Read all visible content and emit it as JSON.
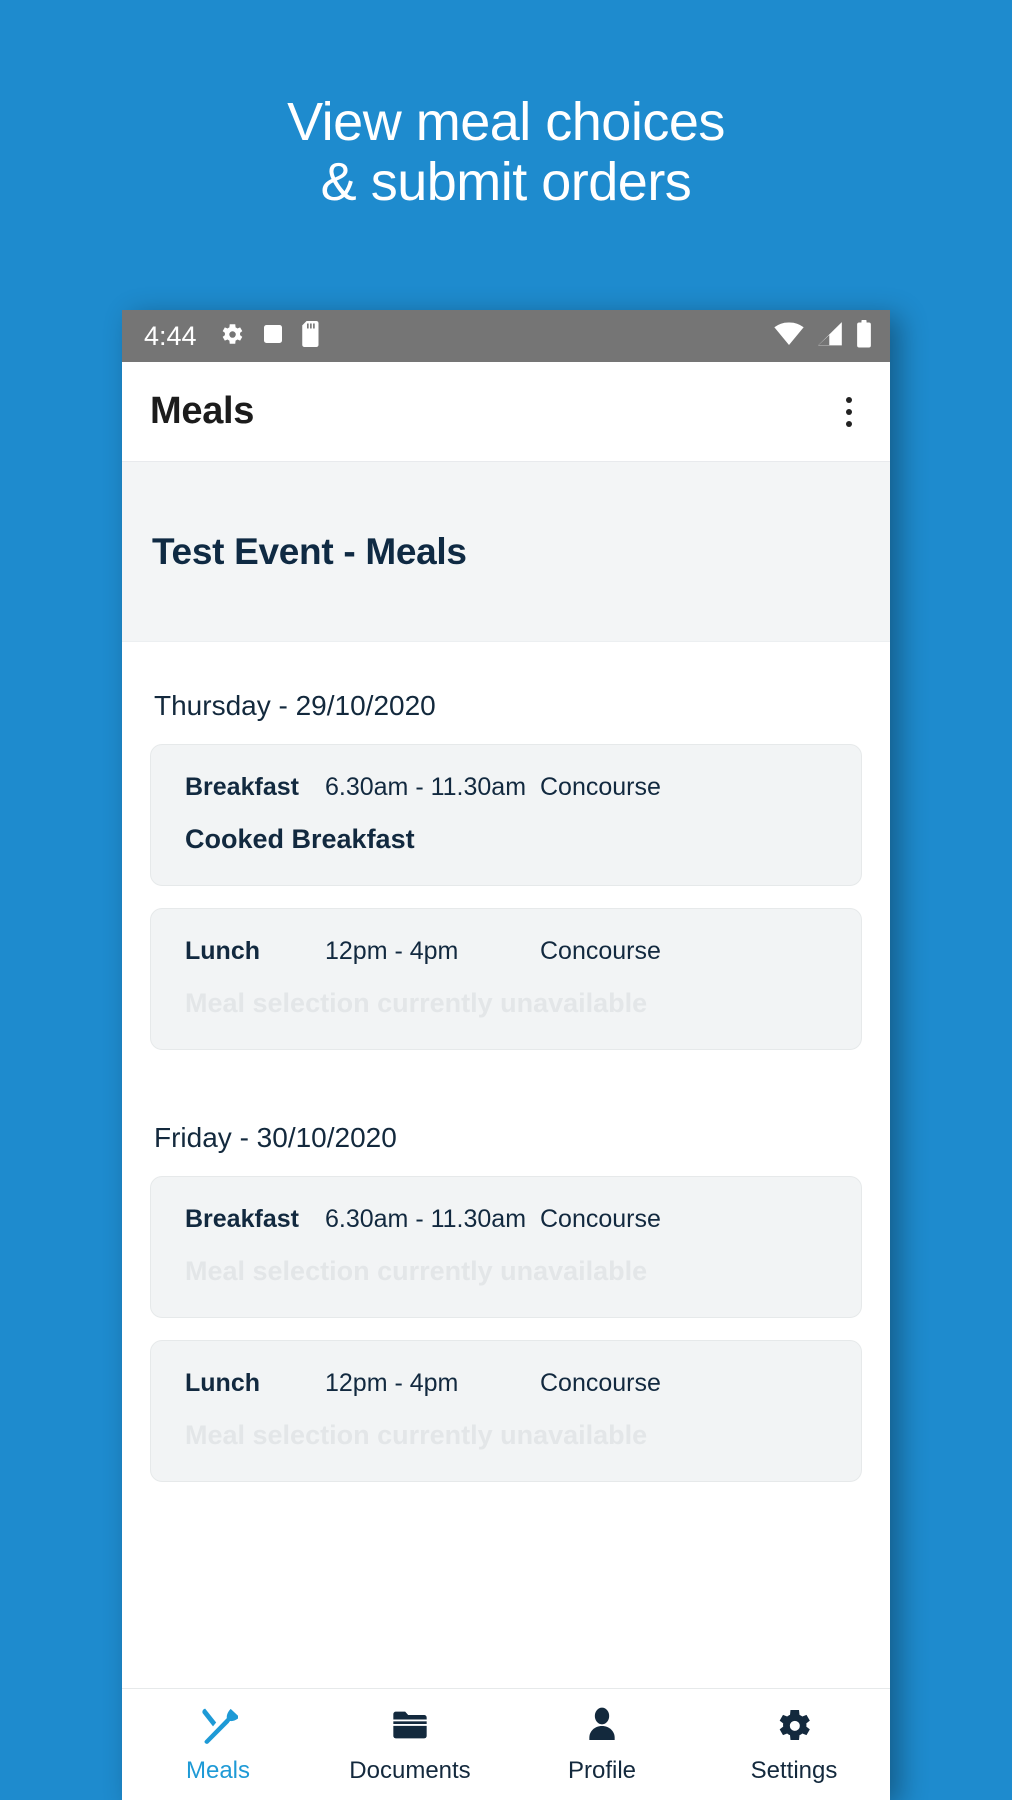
{
  "promo": {
    "line1": "View meal choices",
    "line2": "& submit orders",
    "background_color": "#1e8bce",
    "text_color": "#ffffff"
  },
  "statusbar": {
    "time": "4:44",
    "left_icons": [
      "gear-icon",
      "square-icon",
      "sd-card-icon"
    ],
    "right_icons": [
      "wifi-icon",
      "cell-signal-icon",
      "battery-icon"
    ],
    "background_color": "#757575"
  },
  "appbar": {
    "title": "Meals",
    "overflow_icon": "kebab-menu-icon"
  },
  "event": {
    "title": "Test Event - Meals",
    "title_color": "#0f2a43",
    "band_color": "#f3f5f6"
  },
  "days": [
    {
      "label": "Thursday - 29/10/2020",
      "meals": [
        {
          "type": "Breakfast",
          "time": "6.30am - 11.30am",
          "venue": "Concourse",
          "choice": "Cooked Breakfast",
          "available": true
        },
        {
          "type": "Lunch",
          "time": "12pm - 4pm",
          "venue": "Concourse",
          "choice": "Meal selection currently unavailable",
          "available": false
        }
      ]
    },
    {
      "label": "Friday - 30/10/2020",
      "meals": [
        {
          "type": "Breakfast",
          "time": "6.30am - 11.30am",
          "venue": "Concourse",
          "choice": "Meal selection currently unavailable",
          "available": false
        },
        {
          "type": "Lunch",
          "time": "12pm - 4pm",
          "venue": "Concourse",
          "choice": "Meal selection currently unavailable",
          "available": false
        }
      ]
    }
  ],
  "bottom_nav": {
    "active_color": "#1e9ad6",
    "inactive_color": "#13293d",
    "items": [
      {
        "label": "Meals",
        "icon": "cutlery-icon",
        "active": true
      },
      {
        "label": "Documents",
        "icon": "folder-icon",
        "active": false
      },
      {
        "label": "Profile",
        "icon": "person-icon",
        "active": false
      },
      {
        "label": "Settings",
        "icon": "gear-icon",
        "active": false
      }
    ]
  }
}
